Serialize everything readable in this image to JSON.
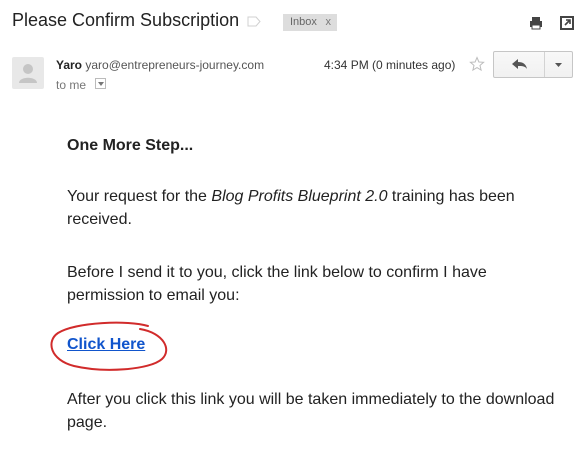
{
  "header": {
    "subject": "Please Confirm Subscription",
    "label_chip": "Inbox",
    "label_remove": "x"
  },
  "message": {
    "sender_name": "Yaro",
    "sender_email": "yaro@entrepreneurs-journey.com",
    "recipient": "to me",
    "timestamp": "4:34 PM (0 minutes ago)"
  },
  "body": {
    "heading": "One More Step...",
    "para1_before": "Your request for the ",
    "para1_italic": "Blog Profits Blueprint 2.0",
    "para1_after": " training has been received.",
    "para2": "Before I send it to you, click the link below to confirm I have permission to email you:",
    "link_label": "Click Here",
    "para3": "After you click this link you will be taken immediately to the download page."
  },
  "icons": {
    "important": "important-marker-icon",
    "print": "print-icon",
    "popout": "new-window-icon",
    "star": "star-icon",
    "reply": "reply-arrow-icon",
    "more": "chevron-down-icon",
    "avatar": "person-silhouette-icon"
  },
  "colors": {
    "link": "#1155cc",
    "annotation_circle": "#d12b2b",
    "chip_bg": "#dddddd"
  }
}
